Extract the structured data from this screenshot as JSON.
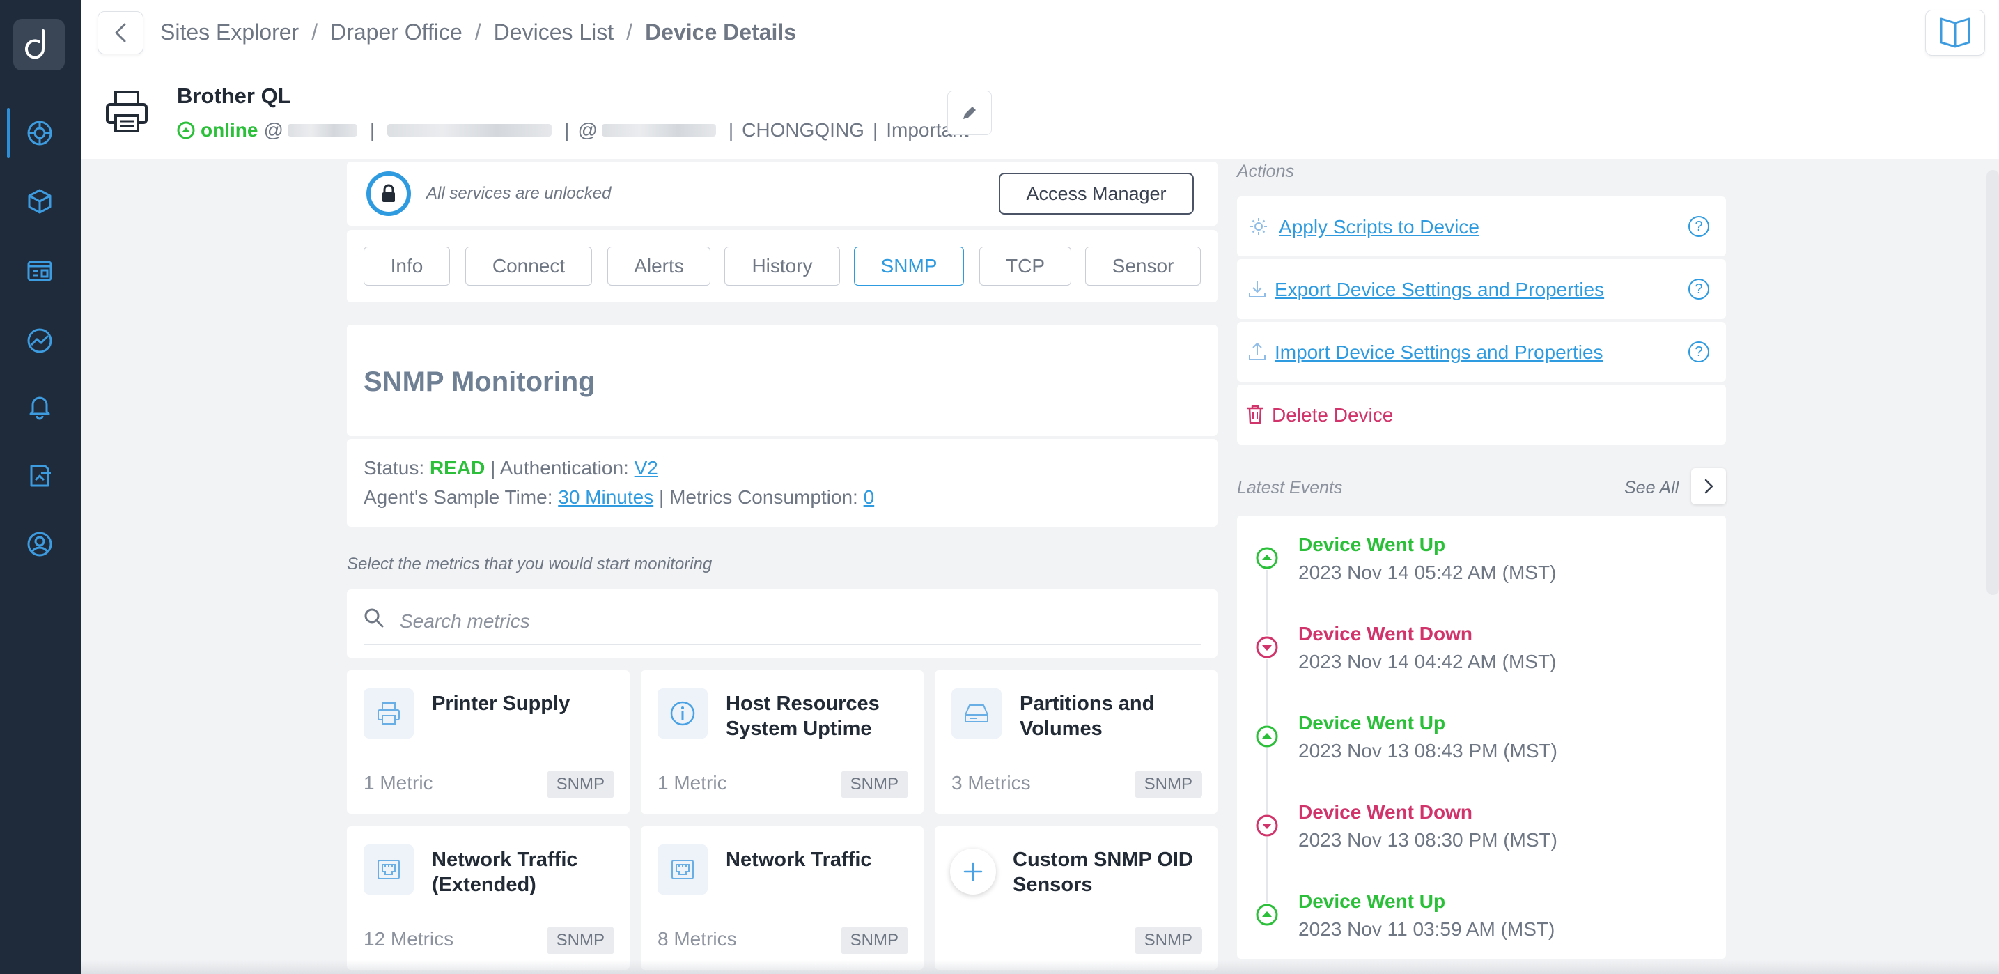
{
  "breadcrumb": {
    "items": [
      "Sites Explorer",
      "Draper Office",
      "Devices List"
    ],
    "current": "Device Details",
    "separator": "/"
  },
  "device": {
    "name": "Brother QL",
    "status": "online",
    "at_symbol": "@",
    "at_symbol_2": "@",
    "location": "CHONGQING",
    "importance": "Important",
    "meta_separator": "|"
  },
  "lock": {
    "text": "All services are unlocked",
    "access_button": "Access Manager"
  },
  "tabs": [
    {
      "label": "Info",
      "active": false
    },
    {
      "label": "Connect",
      "active": false
    },
    {
      "label": "Alerts",
      "active": false
    },
    {
      "label": "History",
      "active": false
    },
    {
      "label": "SNMP",
      "active": true
    },
    {
      "label": "TCP",
      "active": false
    },
    {
      "label": "Sensor",
      "active": false
    }
  ],
  "snmp": {
    "title": "SNMP Monitoring",
    "status_label": "Status:",
    "status_value": "READ",
    "auth_label": "Authentication:",
    "auth_value": "V2",
    "sample_label": "Agent's Sample Time:",
    "sample_value": "30 Minutes",
    "consumption_label": "Metrics Consumption:",
    "consumption_value": "0",
    "separator": "|",
    "hint": "Select the metrics that you would start monitoring",
    "search_placeholder": "Search metrics"
  },
  "metrics": [
    {
      "title": "Printer Supply",
      "count": "1 Metric",
      "badge": "SNMP",
      "icon": "printer-icon"
    },
    {
      "title": "Host Resources System Uptime",
      "count": "1 Metric",
      "badge": "SNMP",
      "icon": "info-icon"
    },
    {
      "title": "Partitions and Volumes",
      "count": "3 Metrics",
      "badge": "SNMP",
      "icon": "drive-icon"
    },
    {
      "title": "Network Traffic (Extended)",
      "count": "12 Metrics",
      "badge": "SNMP",
      "icon": "ethernet-port-icon"
    },
    {
      "title": "Network Traffic",
      "count": "8 Metrics",
      "badge": "SNMP",
      "icon": "ethernet-port-icon"
    },
    {
      "title": "Custom SNMP OID Sensors",
      "count": "",
      "badge": "SNMP",
      "icon": "plus-icon"
    }
  ],
  "actions": {
    "label": "Actions",
    "items": [
      {
        "label": "Apply Scripts to Device",
        "icon": "gear-icon",
        "help": "?"
      },
      {
        "label": "Export Device Settings and Properties",
        "icon": "download-icon",
        "help": "?"
      },
      {
        "label": "Import Device Settings and Properties",
        "icon": "upload-icon",
        "help": "?"
      }
    ],
    "delete_label": "Delete Device"
  },
  "events": {
    "label": "Latest Events",
    "see_all": "See All",
    "items": [
      {
        "title": "Device Went Up",
        "time": "2023 Nov 14 05:42 AM (MST)",
        "type": "up"
      },
      {
        "title": "Device Went Down",
        "time": "2023 Nov 14 04:42 AM (MST)",
        "type": "down"
      },
      {
        "title": "Device Went Up",
        "time": "2023 Nov 13 08:43 PM (MST)",
        "type": "up"
      },
      {
        "title": "Device Went Down",
        "time": "2023 Nov 13 08:30 PM (MST)",
        "type": "down"
      },
      {
        "title": "Device Went Up",
        "time": "2023 Nov 11 03:59 AM (MST)",
        "type": "up"
      }
    ]
  },
  "colors": {
    "sidebar": "#1f2b3a",
    "accent": "#2e9be0",
    "online": "#2bbf3a",
    "danger": "#d1346a"
  }
}
